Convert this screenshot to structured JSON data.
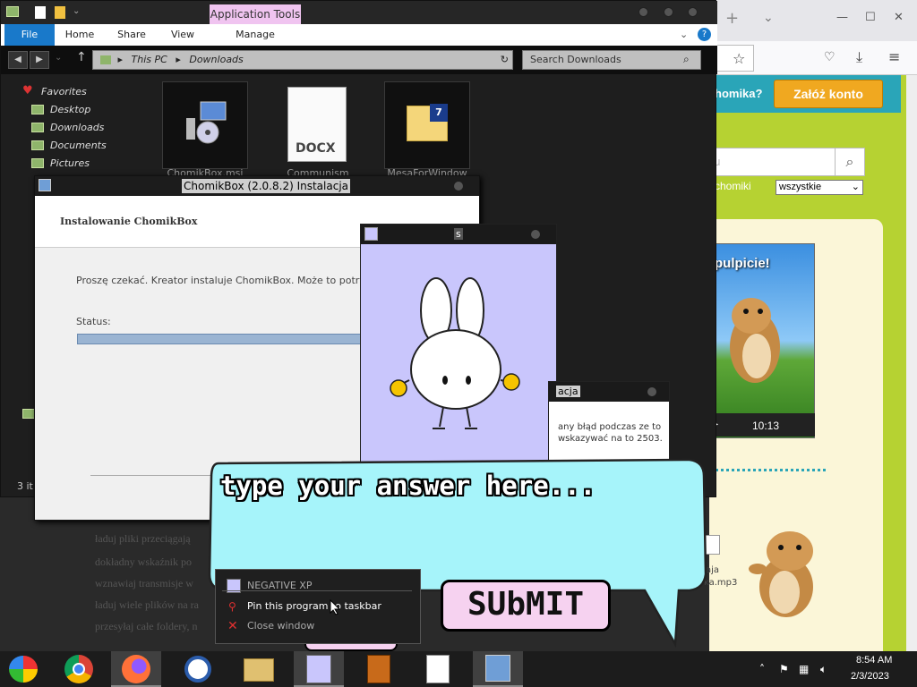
{
  "browser": {
    "site_question": "homika?",
    "register_label": "Załóż konto",
    "search_fragment": "u",
    "chomiki_label": "chomiki",
    "filter_value": "wszystkie",
    "video_title": "pulpicie!",
    "video_time": "10:13",
    "side_file": "ka.mp3",
    "side_file2": "aja"
  },
  "explorer": {
    "ribbon": {
      "app_tools": "Application Tools",
      "tabs": [
        "File",
        "Home",
        "Share",
        "View",
        "Manage"
      ]
    },
    "path": [
      "This PC",
      "Downloads"
    ],
    "search_placeholder": "Search Downloads",
    "nav": [
      "Favorites",
      "Desktop",
      "Downloads",
      "Documents",
      "Pictures"
    ],
    "files": [
      "ChomikBox.msi",
      "Communism",
      "MesaForWindow"
    ],
    "docx_label": "DOCX",
    "status": "3 it"
  },
  "installer": {
    "title": "ChomikBox (2.0.8.2) Instalacja",
    "heading": "Instalowanie ChomikBox",
    "message": "Proszę czekać. Kreator instaluje ChomikBox. Może to potrwać kilka",
    "status_label": "Status:",
    "progress": 1.0
  },
  "bunny_window": {
    "title": "s"
  },
  "error_dialog": {
    "title": "acja",
    "message": "any błąd podczas ze to wskazywać na to 2503."
  },
  "bubble": {
    "prompt": "type your answer here...",
    "submit_label": "SUbMIT"
  },
  "background_text": [
    "ładuj pliki przeciągają",
    "dokładny wskaźnik po",
    "wznawiaj transmisje w",
    "ładuj wiele plików na ra",
    "przesyłaj całe foldery, n"
  ],
  "context_menu": {
    "app_name": "NEGATIVE XP",
    "pin_label": "Pin this program to taskbar",
    "close_label": "Close window"
  },
  "clock": {
    "time": "8:54 AM",
    "date": "2/3/2023"
  }
}
